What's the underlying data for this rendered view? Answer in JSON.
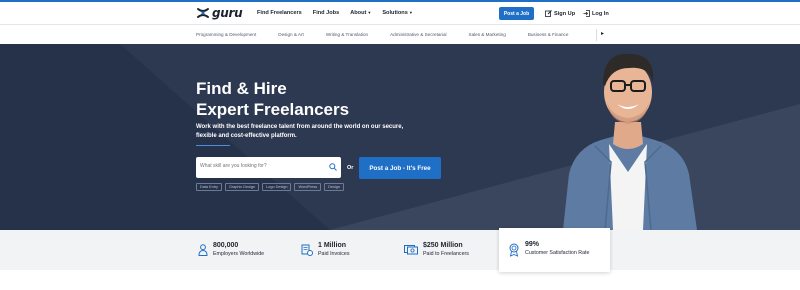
{
  "header": {
    "logo_text": "guru",
    "nav": [
      {
        "label": "Find Freelancers",
        "caret": false
      },
      {
        "label": "Find Jobs",
        "caret": false
      },
      {
        "label": "About",
        "caret": true
      },
      {
        "label": "Solutions",
        "caret": true
      }
    ],
    "post_job_label": "Post a Job",
    "signup_label": "Sign Up",
    "login_label": "Log In"
  },
  "categories": [
    "Programming & Development",
    "Design & Art",
    "Writing & Translation",
    "Administrative & Secretarial",
    "Sales & Marketing",
    "Business & Finance"
  ],
  "hero": {
    "title_line1": "Find & Hire",
    "title_line2": "Expert Freelancers",
    "subtitle": "Work with the best freelance talent from around the world on our secure, flexible and cost-effective platform.",
    "search_placeholder": "What skill are you looking for?",
    "or_label": "Or",
    "cta_label": "Post a Job - It's Free",
    "tags": [
      "Data Entry",
      "Graphic Design",
      "Logo Design",
      "WordPress",
      "Design"
    ]
  },
  "stats": [
    {
      "value": "800,000",
      "label": "Employers Worldwide",
      "icon": "person-icon"
    },
    {
      "value": "1 Million",
      "label": "Paid Invoices",
      "icon": "invoice-icon"
    },
    {
      "value": "$250 Million",
      "label": "Paid to Freelancers",
      "icon": "money-icon"
    },
    {
      "value": "99%",
      "label": "Customer Satisfaction Rate",
      "icon": "award-icon"
    }
  ],
  "colors": {
    "accent": "#1f6fc6",
    "hero_bg": "#2d3950",
    "stats_bg": "#f2f3f5"
  }
}
